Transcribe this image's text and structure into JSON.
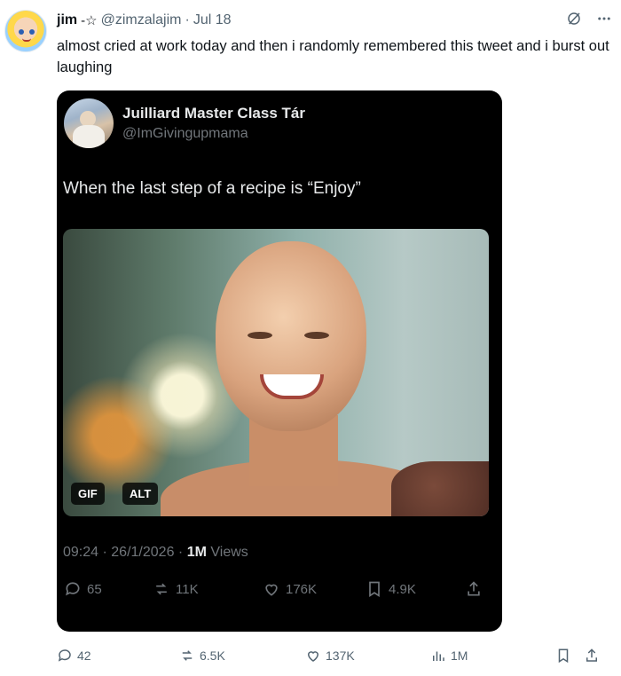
{
  "tweet": {
    "name": "jim",
    "name_suffix": "-☆",
    "handle": "@zimzalajim",
    "separator": "·",
    "date": "Jul 18",
    "text": "almost cried at work today and then i randomly remembered this tweet and i burst out laughing",
    "icons": [
      "grok-icon",
      "more-icon"
    ]
  },
  "quoted": {
    "name": "Juilliard Master Class Tár",
    "handle": "@ImGivingupmama",
    "text": "When the last step of a recipe is “Enjoy”",
    "media_badges": {
      "gif": "GIF",
      "alt": "ALT"
    },
    "time": "09:24",
    "date": "26/1/2026",
    "views_count": "1M",
    "views_label": "Views",
    "stats": {
      "replies": "65",
      "reposts": "11K",
      "likes": "176K",
      "bookmarks": "4.9K"
    }
  },
  "actions": {
    "replies": "42",
    "reposts": "6.5K",
    "likes": "137K",
    "views": "1M"
  }
}
